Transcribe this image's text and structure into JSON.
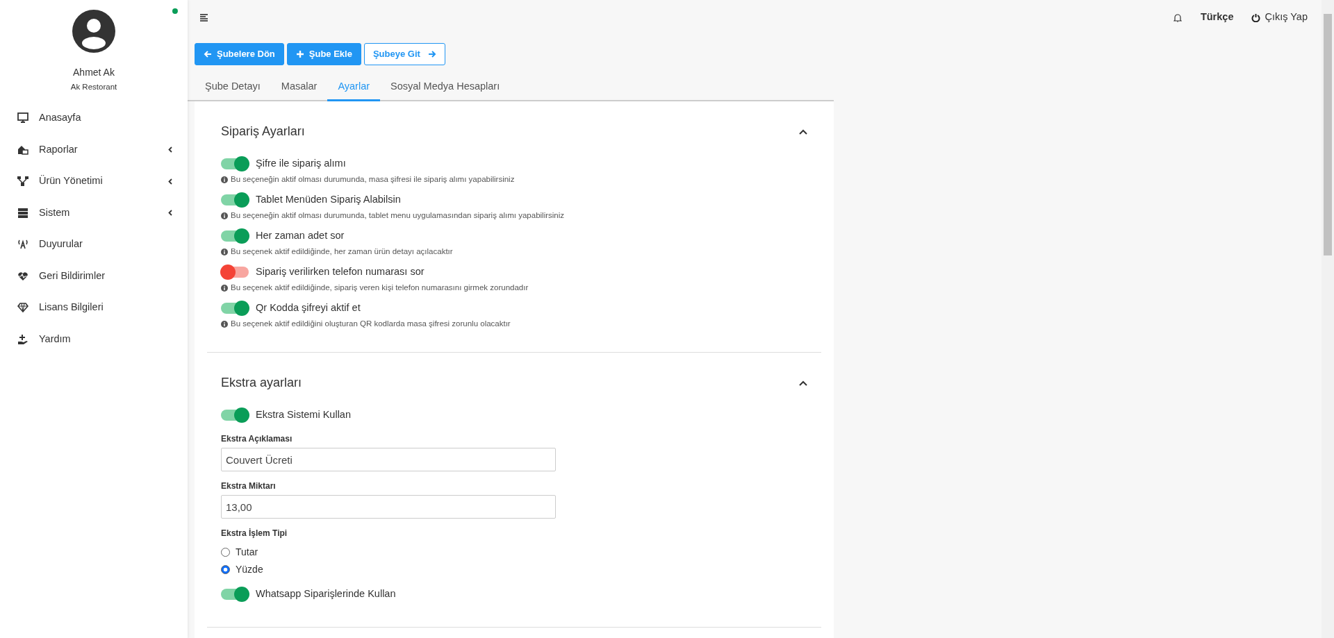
{
  "user": {
    "name": "Ahmet Ak",
    "company": "Ak Restorant",
    "online": true
  },
  "sidebar": {
    "items": [
      {
        "label": "Anasayfa",
        "kind": "link"
      },
      {
        "label": "Raporlar",
        "kind": "submenu"
      },
      {
        "label": "Ürün Yönetimi",
        "kind": "submenu"
      },
      {
        "label": "Sistem",
        "kind": "submenu"
      },
      {
        "label": "Duyurular",
        "kind": "link"
      },
      {
        "label": "Geri Bildirimler",
        "kind": "link"
      },
      {
        "label": "Lisans Bilgileri",
        "kind": "link"
      },
      {
        "label": "Yardım",
        "kind": "link"
      }
    ]
  },
  "topbar": {
    "language": "Türkçe",
    "logout": "Çıkış Yap"
  },
  "actions": [
    {
      "label": "Şubelere Dön",
      "kind": "back"
    },
    {
      "label": "Şube Ekle",
      "kind": "add"
    },
    {
      "label": "Şubeye Git",
      "kind": "go"
    }
  ],
  "tabs": [
    {
      "label": "Şube Detayı",
      "selected": false
    },
    {
      "label": "Masalar",
      "selected": false
    },
    {
      "label": "Ayarlar",
      "selected": true
    },
    {
      "label": "Sosyal Medya Hesapları",
      "selected": false
    }
  ],
  "sections": [
    {
      "title": "Sipariş Ayarları",
      "expanded": true,
      "items": [
        {
          "kind": "switch",
          "label": "Şifre ile sipariş alımı",
          "on": true,
          "hint": "Bu seçeneğin aktif olması durumunda, masa şifresi ile sipariş alımı yapabilirsiniz"
        },
        {
          "kind": "switch",
          "label": "Tablet Menüden Sipariş Alabilsin",
          "on": true,
          "hint": "Bu seçeneğin aktif olması durumunda, tablet menu uygulamasından sipariş alımı yapabilirsiniz"
        },
        {
          "kind": "switch",
          "label": "Her zaman adet sor",
          "on": true,
          "hint": "Bu seçenek aktif edildiğinde, her zaman ürün detayı açılacaktır"
        },
        {
          "kind": "switch",
          "label": "Sipariş verilirken telefon numarası sor",
          "on": false,
          "hint": "Bu seçenek aktif edildiğinde, sipariş veren kişi telefon numarasını girmek zorundadır"
        },
        {
          "kind": "switch",
          "label": "Qr Kodda şifreyi aktif et",
          "on": true,
          "hint": "Bu seçenek aktif edildiğini oluşturan QR kodlarda masa şifresi zorunlu olacaktır"
        }
      ]
    },
    {
      "title": "Ekstra ayarları",
      "expanded": true,
      "items": [
        {
          "kind": "switch",
          "label": "Ekstra Sistemi Kullan",
          "on": true
        },
        {
          "kind": "input",
          "label": "Ekstra Açıklaması",
          "value": "Couvert Ücreti"
        },
        {
          "kind": "input",
          "label": "Ekstra Miktarı",
          "value": "13,00"
        },
        {
          "kind": "radio",
          "label": "Ekstra İşlem Tipi",
          "options": [
            {
              "label": "Tutar",
              "selected": false
            },
            {
              "label": "Yüzde",
              "selected": true
            }
          ]
        },
        {
          "kind": "switch",
          "label": "Whatsapp Siparişlerinde Kullan",
          "on": true
        }
      ]
    }
  ]
}
